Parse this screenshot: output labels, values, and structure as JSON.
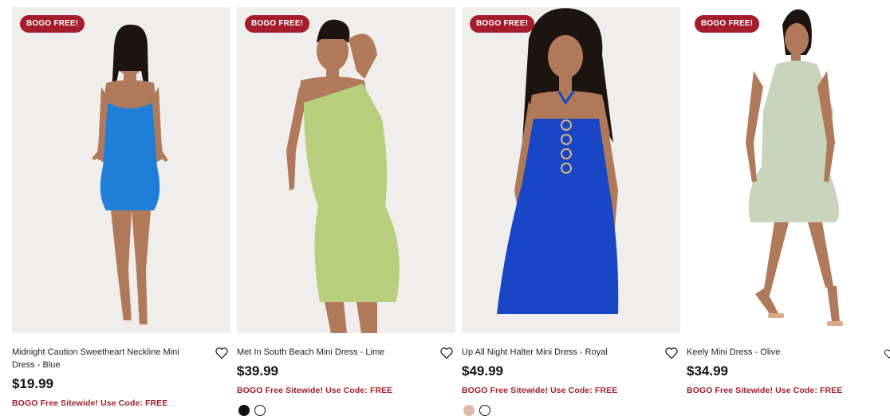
{
  "products": [
    {
      "badge": "BOGO FREE!",
      "title": "Midnight Caution Sweetheart Neckline Mini Dress - Blue",
      "price": "$19.99",
      "promo": "BOGO Free Sitewide! Use Code: FREE",
      "dress_color": "#1f7fd8",
      "icon": "heart-icon"
    },
    {
      "badge": "BOGO FREE!",
      "title": "Met In South Beach Mini Dress - Lime",
      "price": "$39.99",
      "promo": "BOGO Free Sitewide! Use Code: FREE",
      "dress_color": "#b7cf7d",
      "icon": "heart-icon"
    },
    {
      "badge": "BOGO FREE!",
      "title": "Up All Night Halter Mini Dress - Royal",
      "price": "$49.99",
      "promo": "BOGO Free Sitewide! Use Code: FREE",
      "dress_color": "#1846c4",
      "icon": "heart-icon"
    },
    {
      "badge": "BOGO FREE!",
      "title": "Keely Mini Dress - Olive",
      "price": "$34.99",
      "promo": "BOGO Free Sitewide! Use Code: FREE",
      "dress_color": "#c9d4bd",
      "icon": "heart-icon"
    }
  ],
  "colors": {
    "accent": "#a51d2b",
    "skin": "#b07a5a",
    "hair": "#1c1410"
  }
}
